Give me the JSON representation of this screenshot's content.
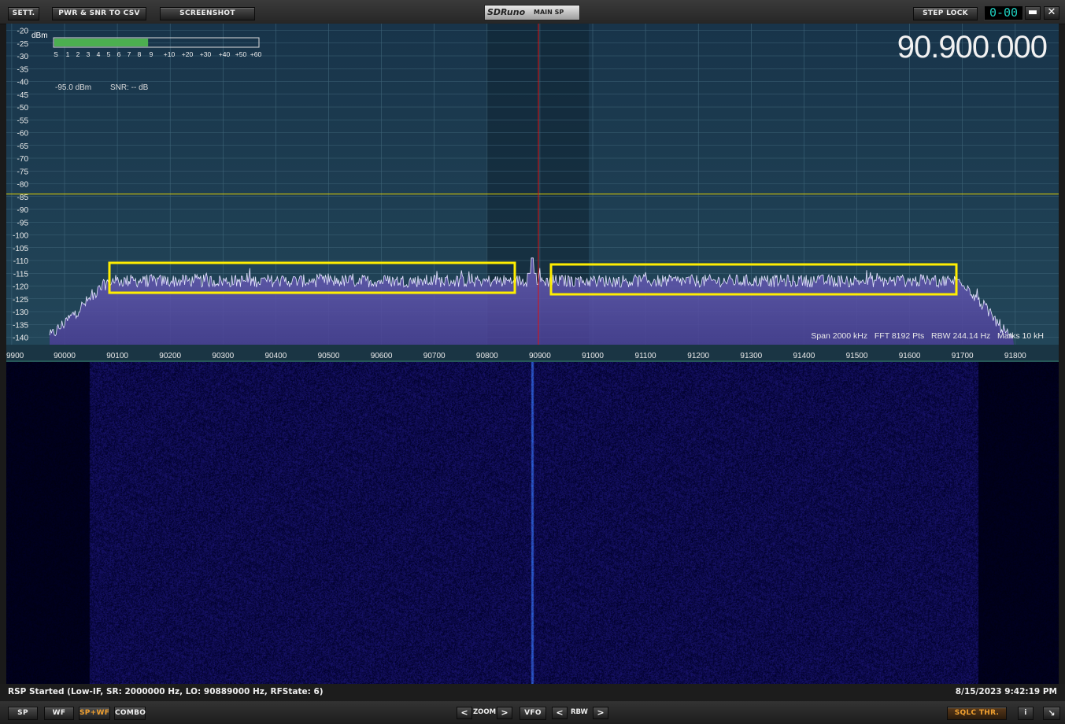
{
  "toolbar": {
    "sett_label": "SETT.",
    "pwr_snr_label": "PWR & SNR TO CSV",
    "screenshot_label": "SCREENSHOT",
    "step_lock_label": "STEP LOCK",
    "step_display": "0-00",
    "minimize_glyph": "▬",
    "close_glyph": "✕"
  },
  "title": {
    "logo": "SDRuno",
    "window": "MAIN SP"
  },
  "spectrum": {
    "frequency_display": "90.900.000",
    "unit_label": "dBm",
    "y_ticks": [
      "-20",
      "-25",
      "-30",
      "-35",
      "-40",
      "-45",
      "-50",
      "-55",
      "-60",
      "-65",
      "-70",
      "-75",
      "-80",
      "-85",
      "-90",
      "-95",
      "-100",
      "-105",
      "-110",
      "-115",
      "-120",
      "-125",
      "-130",
      "-135",
      "-140"
    ],
    "x_ticks": [
      "9900",
      "90000",
      "90100",
      "90200",
      "90300",
      "90400",
      "90500",
      "90600",
      "90700",
      "90800",
      "90900",
      "91000",
      "91100",
      "91200",
      "91300",
      "91400",
      "91500",
      "91600",
      "91700",
      "91800"
    ],
    "smeter_labels": [
      "S",
      "1",
      "2",
      "3",
      "4",
      "5",
      "6",
      "7",
      "8",
      "9",
      "+10",
      "+20",
      "+30",
      "+40",
      "+50",
      "+60"
    ],
    "smeter_fill_fraction": 0.46,
    "power_readout": "-95.0 dBm",
    "snr_readout": "SNR: -- dB",
    "info_line": "Span 2000 kHz   FFT 8192 Pts   RBW 244.14 Hz   Marks 10 kH",
    "threshold_dbm": -84,
    "noise_floor_dbm": -118,
    "colors": {
      "fill": "#5a4fa3",
      "trace": "#e6e6ff",
      "center_marker": "#e01010",
      "threshold": "#e0d000",
      "highlight": "#ffee00"
    }
  },
  "status": {
    "left": "RSP Started (Low-IF, SR: 2000000 Hz, LO: 90889000 Hz, RFState: 6)",
    "right": "8/15/2023 9:42:19 PM"
  },
  "bottom": {
    "sp": "SP",
    "wf": "WF",
    "spwf": "SP+WF",
    "combo": "COMBO",
    "zoom": "ZOOM",
    "vfo": "VFO",
    "rbw": "RBW",
    "left_arrow": "<",
    "right_arrow": ">",
    "sqlc": "SQLC THR.",
    "info": "i",
    "resize_glyph": "↘"
  }
}
